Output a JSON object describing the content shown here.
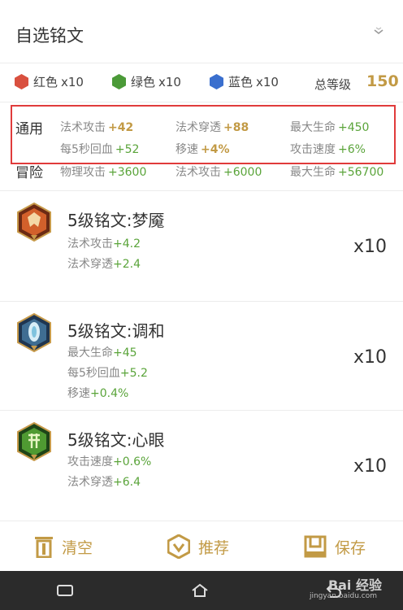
{
  "header": {
    "title": "自选铭文"
  },
  "summary": {
    "gems": [
      {
        "label": "红色",
        "count": "x10",
        "color": "#d9503f"
      },
      {
        "label": "绿色",
        "count": "x10",
        "color": "#4b9a38"
      },
      {
        "label": "蓝色",
        "count": "x10",
        "color": "#3a6fce"
      }
    ],
    "total_label": "总等级",
    "total_value": "150"
  },
  "stats": {
    "general_label": "通用",
    "adventure_label": "冒险",
    "general": [
      {
        "name": "法术攻击",
        "value": "+42",
        "style": "bold"
      },
      {
        "name": "法术穿透",
        "value": "+88",
        "style": "bold"
      },
      {
        "name": "最大生命",
        "value": "+450",
        "style": "green"
      },
      {
        "name": "每5秒回血",
        "value": "+52",
        "style": "green"
      },
      {
        "name": "移速",
        "value": "+4%",
        "style": "bold"
      },
      {
        "name": "攻击速度",
        "value": "+6%",
        "style": "green"
      }
    ],
    "adventure": [
      {
        "name": "物理攻击",
        "value": "+3600"
      },
      {
        "name": "法术攻击",
        "value": "+6000"
      },
      {
        "name": "最大生命",
        "value": "+56700"
      }
    ]
  },
  "runes": [
    {
      "name": "5级铭文:梦魇",
      "icon": "nightmare-rune-icon",
      "qty": "x10",
      "attrs": [
        {
          "name": "法术攻击",
          "value": "+4.2"
        },
        {
          "name": "法术穿透",
          "value": "+2.4"
        }
      ]
    },
    {
      "name": "5级铭文:调和",
      "icon": "harmony-rune-icon",
      "qty": "x10",
      "attrs": [
        {
          "name": "最大生命",
          "value": "+45"
        },
        {
          "name": "每5秒回血",
          "value": "+5.2"
        },
        {
          "name": "移速",
          "value": "+0.4%"
        }
      ]
    },
    {
      "name": "5级铭文:心眼",
      "icon": "insight-rune-icon",
      "qty": "x10",
      "attrs": [
        {
          "name": "攻击速度",
          "value": "+0.6%"
        },
        {
          "name": "法术穿透",
          "value": "+6.4"
        }
      ]
    }
  ],
  "bottom_bar": {
    "clear": "清空",
    "recommend": "推荐",
    "save": "保存"
  },
  "watermark": {
    "text": "Bai 经验",
    "sub": "jingyan.baidu.com"
  },
  "colors": {
    "accent": "#c29a45",
    "green": "#5aa43a",
    "highlight": "#e03b3b"
  }
}
